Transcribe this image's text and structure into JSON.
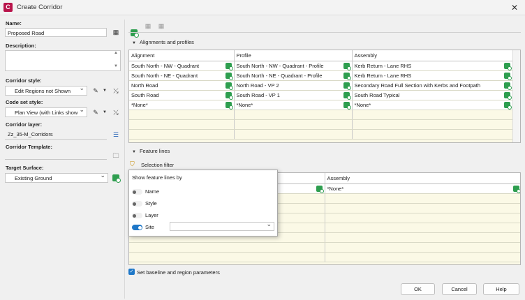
{
  "window": {
    "title": "Create Corridor",
    "app_icon_letter": "C",
    "close_glyph": "✕"
  },
  "left": {
    "name_label": "Name:",
    "name_value": "Proposed Road",
    "description_label": "Description:",
    "corridor_style_label": "Corridor style:",
    "corridor_style_value": "Edit Regions not Shown",
    "code_set_style_label": "Code set style:",
    "code_set_style_value": "Plan View (with Links show",
    "corridor_layer_label": "Corridor layer:",
    "corridor_layer_value": "Zz_35-M_Corridors",
    "corridor_template_label": "Corridor Template:",
    "corridor_template_value": "",
    "target_surface_label": "Target Surface:",
    "target_surface_value": "Existing Ground"
  },
  "alignments": {
    "section_label": "Alignments and profiles",
    "columns": [
      "Alignment",
      "Profile",
      "Assembly"
    ],
    "rows": [
      [
        "South North - NW - Quadrant",
        "South North - NW - Quadrant - Profile",
        "Kerb Return - Lane RHS"
      ],
      [
        "South North - NE - Quadrant",
        "South North - NE - Quadrant - Profile",
        "Kerb Return - Lane RHS"
      ],
      [
        "North Road",
        "North Road - VP 2",
        "Secondary Road Full Section with Kerbs and Footpath"
      ],
      [
        "South Road",
        "South Road - VP 1",
        "South Road Typical"
      ],
      [
        "*None*",
        "*None*",
        "*None*"
      ]
    ]
  },
  "feature_lines": {
    "section_label": "Feature lines",
    "selection_filter_label": "Selection filter",
    "columns": [
      "",
      "Assembly"
    ],
    "rows": [
      [
        "",
        "*None*"
      ]
    ]
  },
  "popup": {
    "title": "Show feature lines by",
    "options": [
      "Name",
      "Style",
      "Layer",
      "Site"
    ],
    "site_value": ""
  },
  "bottom": {
    "baseline_label": "Set baseline and region parameters",
    "ok_label": "OK",
    "cancel_label": "Cancel",
    "help_label": "Help"
  }
}
